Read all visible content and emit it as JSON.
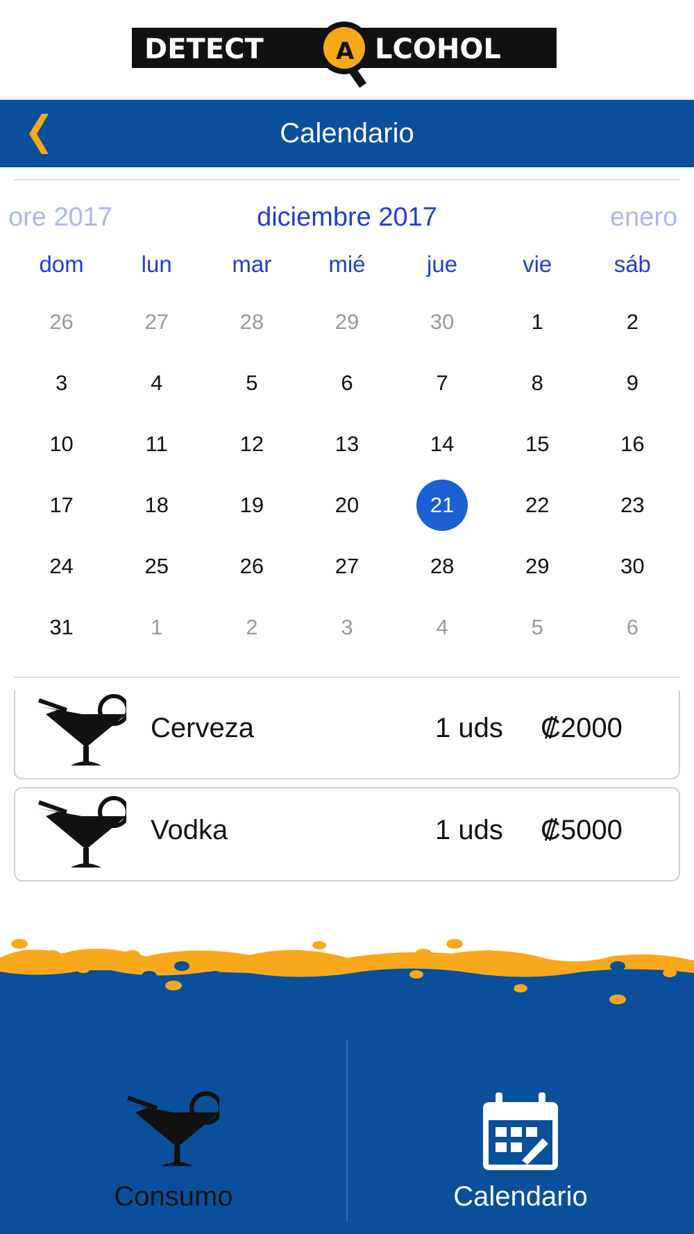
{
  "header": {
    "logo_text": "DETECT ALCOHOL",
    "title": "Calendario",
    "back_icon": "chevron-left-icon"
  },
  "calendar": {
    "prev_month": "ore 2017",
    "current_month": "diciembre 2017",
    "next_month": "enero",
    "weekdays": [
      "dom",
      "lun",
      "mar",
      "mié",
      "jue",
      "vie",
      "sáb"
    ],
    "days": [
      {
        "d": "26",
        "muted": true
      },
      {
        "d": "27",
        "muted": true
      },
      {
        "d": "28",
        "muted": true
      },
      {
        "d": "29",
        "muted": true
      },
      {
        "d": "30",
        "muted": true
      },
      {
        "d": "1"
      },
      {
        "d": "2"
      },
      {
        "d": "3"
      },
      {
        "d": "4"
      },
      {
        "d": "5"
      },
      {
        "d": "6"
      },
      {
        "d": "7"
      },
      {
        "d": "8"
      },
      {
        "d": "9"
      },
      {
        "d": "10"
      },
      {
        "d": "11"
      },
      {
        "d": "12"
      },
      {
        "d": "13"
      },
      {
        "d": "14"
      },
      {
        "d": "15"
      },
      {
        "d": "16"
      },
      {
        "d": "17"
      },
      {
        "d": "18"
      },
      {
        "d": "19"
      },
      {
        "d": "20"
      },
      {
        "d": "21",
        "selected": true
      },
      {
        "d": "22"
      },
      {
        "d": "23"
      },
      {
        "d": "24"
      },
      {
        "d": "25"
      },
      {
        "d": "26"
      },
      {
        "d": "27"
      },
      {
        "d": "28"
      },
      {
        "d": "29"
      },
      {
        "d": "30"
      },
      {
        "d": "31"
      },
      {
        "d": "1",
        "muted": true
      },
      {
        "d": "2",
        "muted": true
      },
      {
        "d": "3",
        "muted": true
      },
      {
        "d": "4",
        "muted": true
      },
      {
        "d": "5",
        "muted": true
      },
      {
        "d": "6",
        "muted": true
      }
    ]
  },
  "entries": [
    {
      "name": "Cerveza",
      "qty": "1 uds",
      "price": "₡2000",
      "icon": "cocktail-icon"
    },
    {
      "name": "Vodka",
      "qty": "1 uds",
      "price": "₡5000",
      "icon": "cocktail-icon"
    }
  ],
  "tabs": [
    {
      "label": "Consumo",
      "icon": "cocktail-icon",
      "active": false
    },
    {
      "label": "Calendario",
      "icon": "calendar-icon",
      "active": true
    }
  ],
  "colors": {
    "brand_blue": "#0a4f9c",
    "accent_orange": "#f7a81b",
    "month_text": "#1f3ed0",
    "selected_day": "#1b5fd4"
  }
}
